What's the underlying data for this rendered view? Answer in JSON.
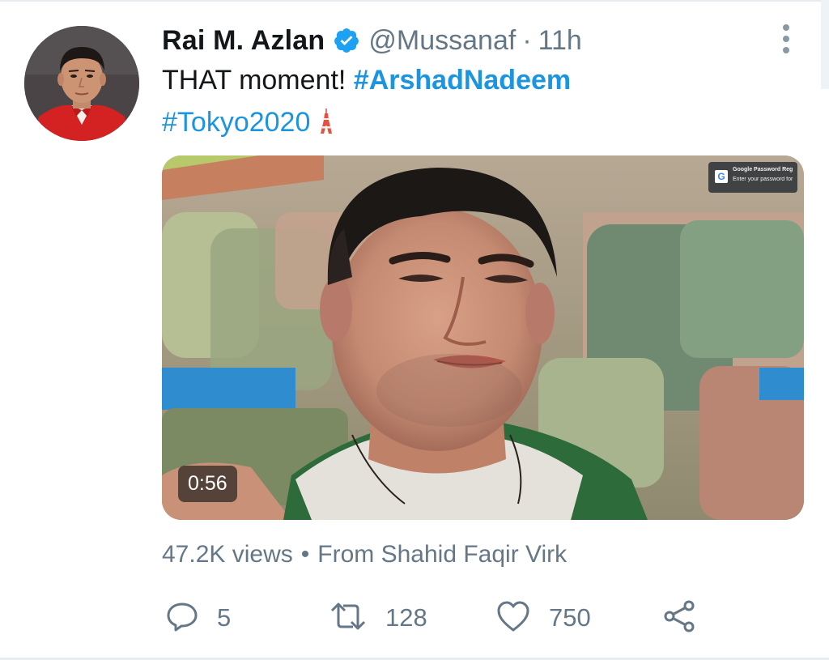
{
  "tweet": {
    "author": {
      "display_name": "Rai M. Azlan",
      "handle": "@Mussanaf",
      "separator": "·",
      "time": "11h",
      "verified": true,
      "avatar_icon": "profile-photo"
    },
    "text": {
      "prefix": "THAT moment! ",
      "hashtag_1": "#ArshadNadeem",
      "hashtag_2": "#Tokyo2020",
      "emoji": "tokyo-tower-emoji"
    },
    "media": {
      "type": "video",
      "duration": "0:56",
      "notification_title": "Google Password Reg",
      "notification_body": "Enter your password for \"Internet Accounts"
    },
    "meta": {
      "views": "47.2K views",
      "separator": "•",
      "source": "From Shahid Faqir Virk"
    },
    "actions": {
      "reply_count": "5",
      "retweet_count": "128",
      "like_count": "750"
    }
  },
  "colors": {
    "link": "#1b95e0",
    "secondary_text": "#657786",
    "primary_text": "#14171a",
    "verified_badge": "#1da1f2"
  }
}
